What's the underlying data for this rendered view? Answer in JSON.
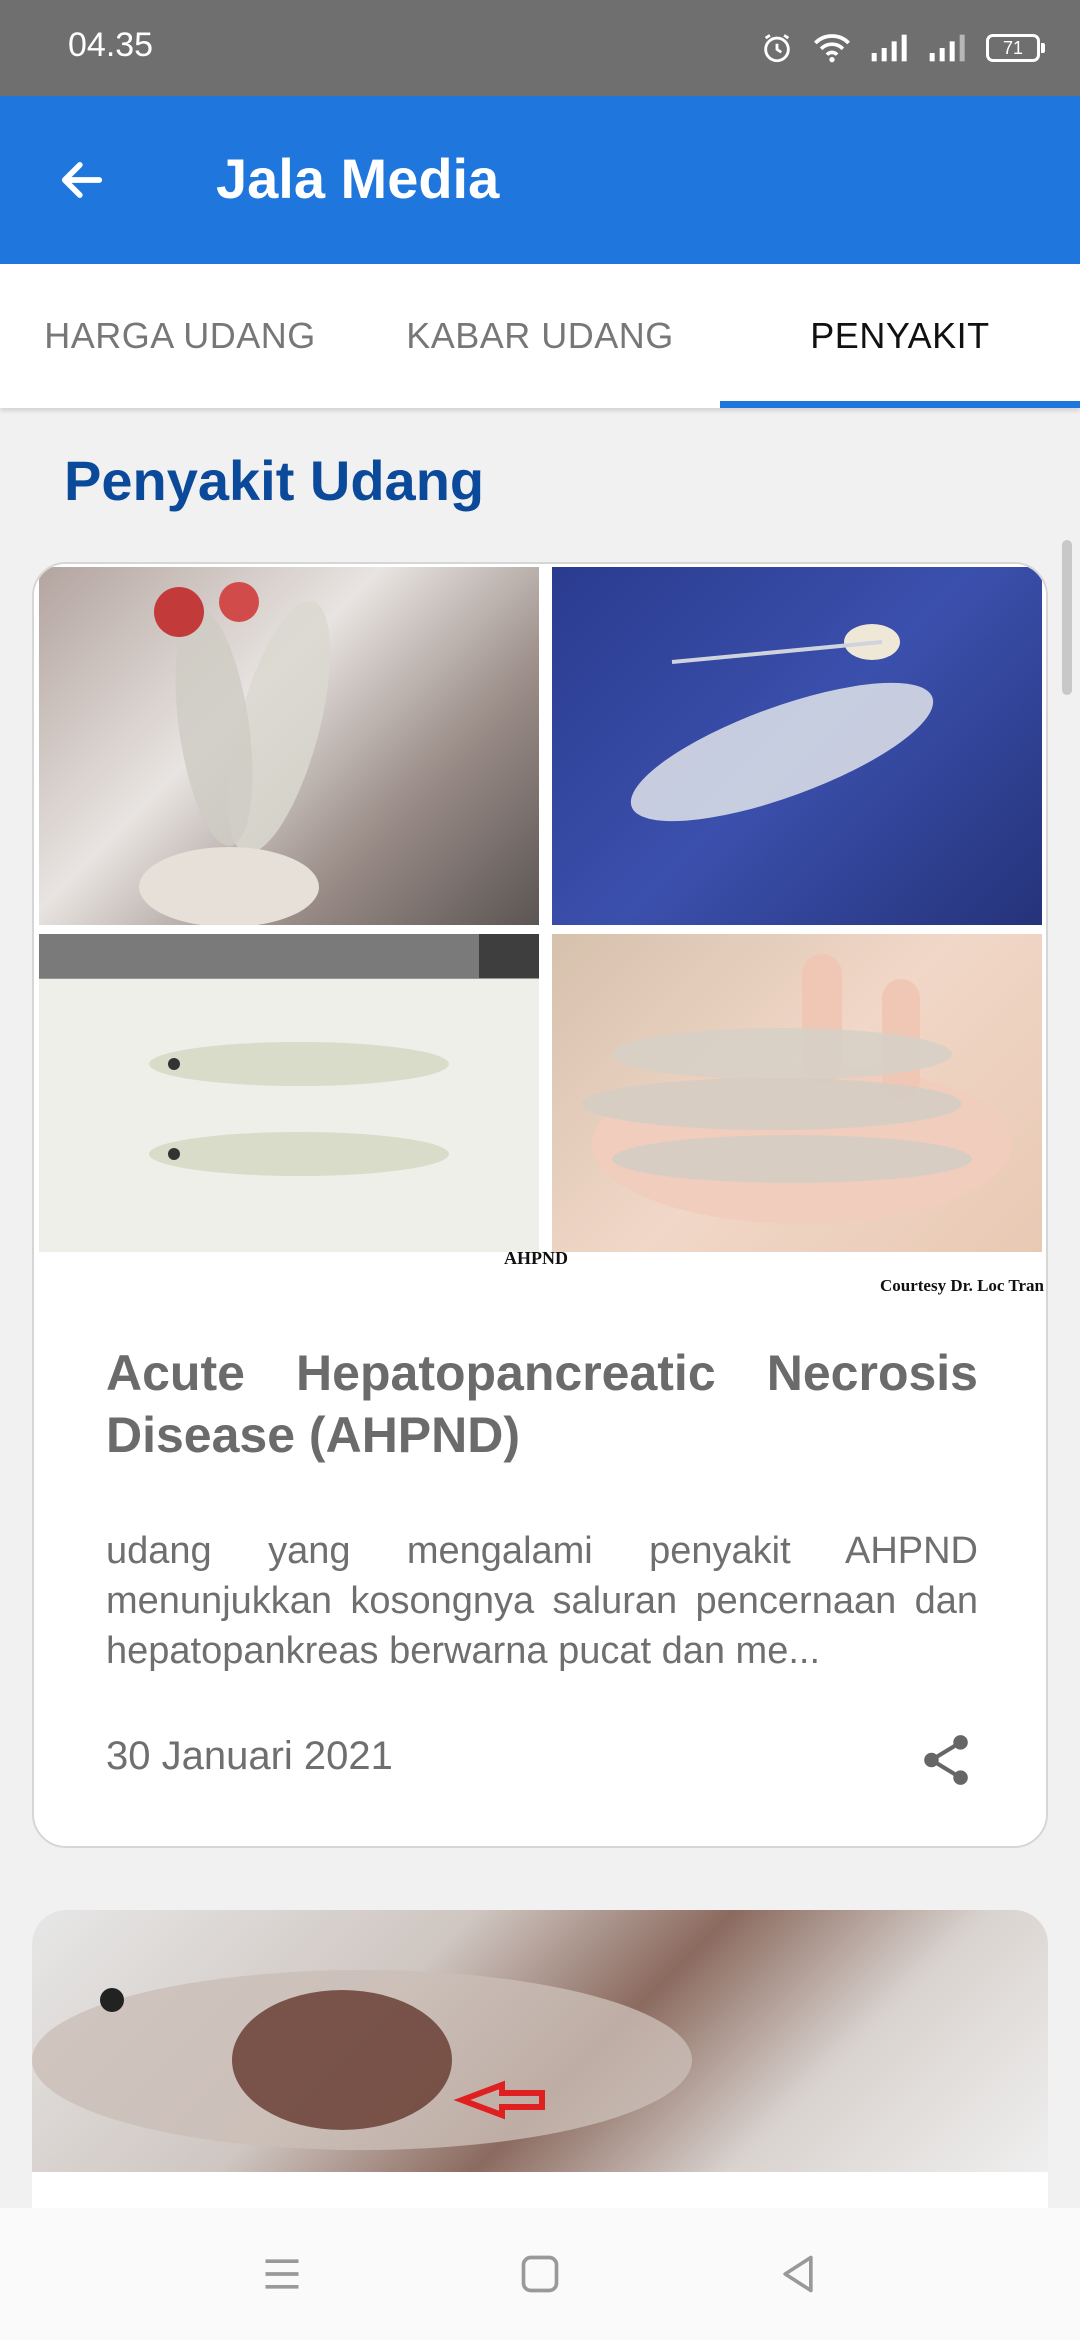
{
  "status_bar": {
    "time": "04.35",
    "battery": "71"
  },
  "app_bar": {
    "title": "Jala Media"
  },
  "tabs": [
    {
      "label": "HARGA UDANG"
    },
    {
      "label": "KABAR UDANG"
    },
    {
      "label": "PENYAKIT",
      "selected": true
    }
  ],
  "section": {
    "title": "Penyakit Udang"
  },
  "cards": [
    {
      "image_label": "AHPND",
      "image_credit": "Courtesy Dr. Loc Tran",
      "title": "Acute Hepatopancreatic Necrosis Disease (AHPND)",
      "description": "udang yang mengalami penyakit AHPND menunjukkan kosongnya saluran pencernaan dan hepatopankreas berwarna pucat dan me...",
      "date": "30 Januari 2021"
    }
  ],
  "icons": {
    "back": "arrow-left-icon",
    "share": "share-icon",
    "nav_menu": "menu-icon",
    "nav_home": "square-icon",
    "nav_back": "triangle-back-icon"
  },
  "colors": {
    "primary": "#1f76dd",
    "section_title": "#0b4a9a",
    "status_bar": "#6f6f6f"
  }
}
